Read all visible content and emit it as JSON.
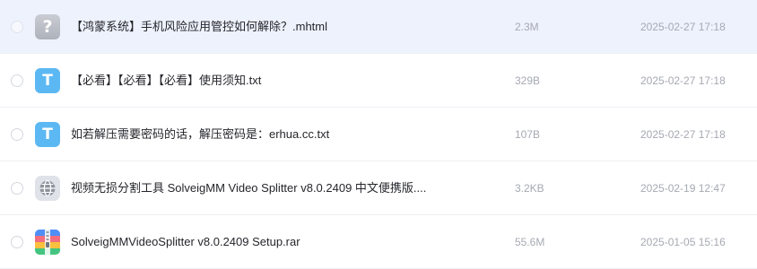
{
  "files": [
    {
      "name": "【鸿蒙系统】手机风险应用管控如何解除？.mhtml",
      "size": "2.3M",
      "date": "2025-02-27 17:18",
      "icon": "unknown-file-icon",
      "icon_glyph": "?"
    },
    {
      "name": "【必看】【必看】【必看】使用须知.txt",
      "size": "329B",
      "date": "2025-02-27 17:18",
      "icon": "text-file-icon",
      "icon_glyph": "T"
    },
    {
      "name": "如若解压需要密码的话，解压密码是：erhua.cc.txt",
      "size": "107B",
      "date": "2025-02-27 17:18",
      "icon": "text-file-icon",
      "icon_glyph": "T"
    },
    {
      "name": "视频无损分割工具 SolveigMM Video Splitter v8.0.2409 中文便携版....",
      "size": "3.2KB",
      "date": "2025-02-19 12:47",
      "icon": "web-link-icon"
    },
    {
      "name": "SolveigMMVideoSplitter v8.0.2409 Setup.rar",
      "size": "55.6M",
      "date": "2025-01-05 15:16",
      "icon": "archive-file-icon"
    }
  ],
  "colors": {
    "selected_row_bg": "#eef2fd",
    "text_file_icon": "#5cb8f3",
    "meta_text": "#a6a9b2"
  }
}
